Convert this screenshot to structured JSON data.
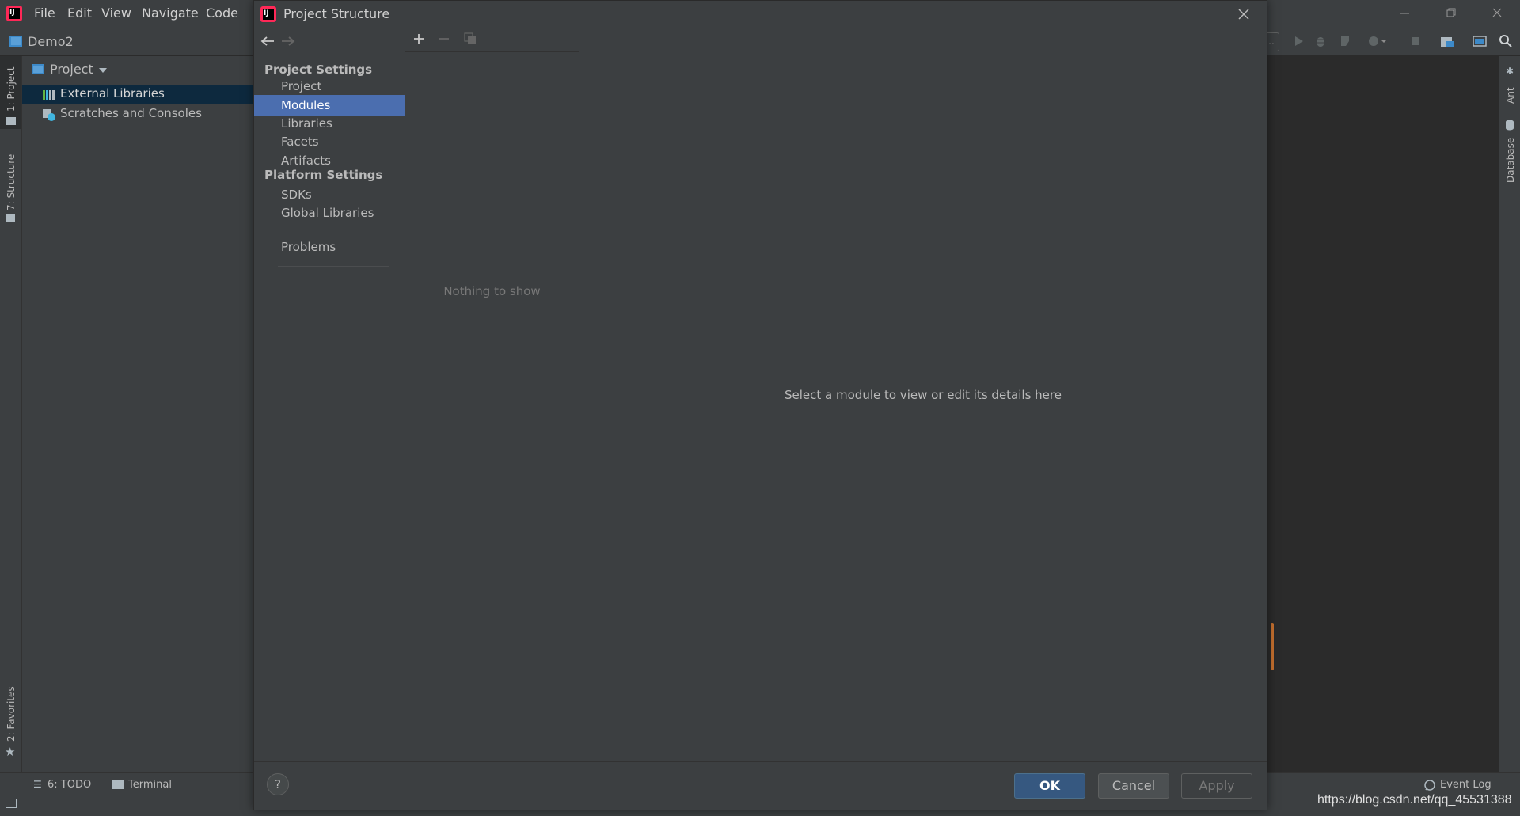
{
  "ide": {
    "menu": [
      "File",
      "Edit",
      "View",
      "Navigate",
      "Code"
    ],
    "project_name": "Demo2",
    "panel_title": "Project",
    "tree": [
      {
        "label": "External Libraries",
        "selected": true,
        "icon": "library-icon"
      },
      {
        "label": "Scratches and Consoles",
        "selected": false,
        "icon": "scratches-icon"
      }
    ],
    "left_tabs": [
      "1: Project",
      "7: Structure",
      "2: Favorites"
    ],
    "right_tabs": [
      "Ant",
      "Database"
    ],
    "bottom_tabs": [
      "6: TODO",
      "Terminal"
    ],
    "event_log": "Event Log",
    "watermark": "https://blog.csdn.net/qq_45531388"
  },
  "dialog": {
    "title": "Project Structure",
    "sections": [
      {
        "heading": "Project Settings",
        "items": [
          "Project",
          "Modules",
          "Libraries",
          "Facets",
          "Artifacts"
        ]
      },
      {
        "heading": "Platform Settings",
        "items": [
          "SDKs",
          "Global Libraries"
        ]
      }
    ],
    "problems": "Problems",
    "selected_item": "Modules",
    "empty_list_text": "Nothing to show",
    "details_hint": "Select a module to view or edit its details here",
    "buttons": {
      "ok": "OK",
      "cancel": "Cancel",
      "apply": "Apply",
      "help": "?"
    }
  },
  "colors": {
    "selection": "#4b6eaf",
    "tree_selection": "#0d293e",
    "ok_button": "#365880",
    "background": "#3c3f41",
    "editor": "#2b2b2b"
  }
}
